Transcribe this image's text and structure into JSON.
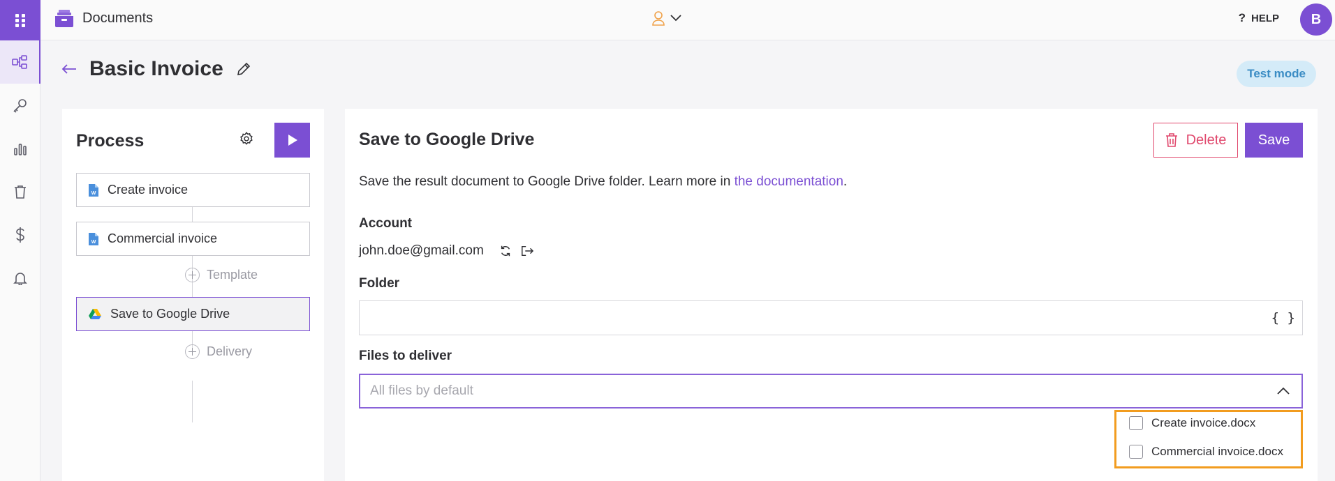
{
  "topbar": {
    "app_name": "Documents",
    "help_label": "HELP",
    "avatar_initial": "B"
  },
  "header": {
    "title": "Basic Invoice",
    "mode_badge": "Test mode"
  },
  "process": {
    "title": "Process",
    "steps": [
      {
        "label": "Create invoice",
        "icon": "word-doc-icon"
      },
      {
        "label": "Commercial invoice",
        "icon": "word-doc-icon"
      },
      {
        "label": "Save to Google Drive",
        "icon": "google-drive-icon"
      }
    ],
    "add_template_label": "Template",
    "add_delivery_label": "Delivery"
  },
  "detail": {
    "title": "Save to Google Drive",
    "delete_label": "Delete",
    "save_label": "Save",
    "description": "Save the result document to Google Drive folder. Learn more in ",
    "doc_link": "the documentation",
    "description_end": ".",
    "account_label": "Account",
    "account_email": "john.doe@gmail.com",
    "folder_label": "Folder",
    "folder_value": "",
    "braces_label": "{ }",
    "files_label": "Files to deliver",
    "files_placeholder": "All files by default",
    "file_options": [
      "Create invoice.docx",
      "Commercial invoice.docx"
    ]
  },
  "colors": {
    "accent": "#7b4fd3",
    "danger": "#e0476c",
    "highlight": "#f29c1f",
    "badge_bg": "#d4ebf8",
    "badge_text": "#3a8cc4"
  }
}
